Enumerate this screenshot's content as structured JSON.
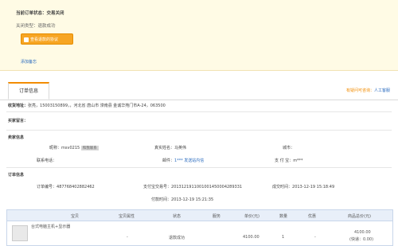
{
  "status_box": {
    "title_label": "当前订单状态：",
    "title_value": "交易关闭",
    "close_type": "关闭类型：退款成功",
    "refund_button": "查看退款的协议",
    "add_note": "添加备忘"
  },
  "tabs": {
    "active": "订单信息",
    "right_label": "有疑问可咨询：",
    "right_link": "人工客服"
  },
  "order": {
    "address_label": "收货地址：",
    "address_value": "张亮，15003150899，，河北省 唐山市 滦南县 金诚华苑门市A-24，063500",
    "buyer_note_label": "买家留言：",
    "seller_section": "卖家信息",
    "nickname_label": "昵称：",
    "nickname_value": "msv0215",
    "nickname_tag": "和我联系",
    "realname_label": "真实姓名：",
    "realname_value": "马英伟",
    "city_label": "城市：",
    "phone_label": "联系电话：",
    "email_label": "邮件：",
    "email_value": "1*** 发送站内信",
    "alipay_label": "支 付 宝：",
    "alipay_value": "m***",
    "order_section": "订单信息",
    "order_no_label": "订单编号：",
    "order_no_value": "487768402882462",
    "trade_no_label": "支付宝交易号：",
    "trade_no_value": "2013121911001001450004289331",
    "created_label": "成交时间：",
    "created_value": "2013-12-19 15:18:49",
    "paid_label": "付款时间：",
    "paid_value": "2013-12-19 15:21:35"
  },
  "table": {
    "headers": [
      "宝贝",
      "宝贝属性",
      "状态",
      "服务",
      "单价(元)",
      "数量",
      "优惠",
      "商品总价(元)"
    ],
    "row": {
      "item": "台式电脑主机+显示器",
      "attr": "-",
      "status": "退款成功",
      "service": "",
      "price": "4100.00",
      "qty": "1",
      "discount": "-",
      "total": "4100.00",
      "total_note": "(快递：0.00)"
    }
  }
}
